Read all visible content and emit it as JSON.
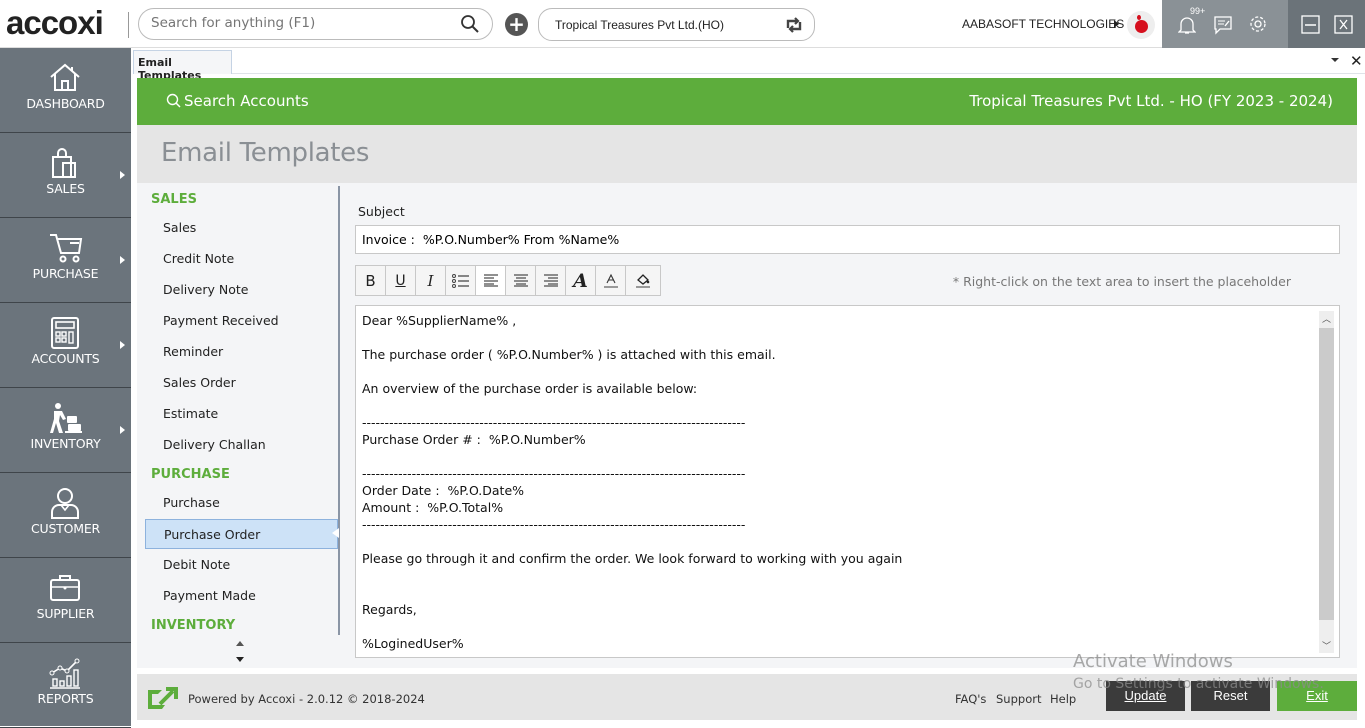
{
  "app": {
    "logo": "accoxi",
    "search_placeholder": "Search for anything (F1)",
    "company": "Tropical Treasures Pvt Ltd.(HO)",
    "org_name": "AABASOFT TECHNOLOGIES",
    "notification_count": "99+"
  },
  "sidebar": {
    "items": [
      {
        "label": "DASHBOARD",
        "icon": "home-icon"
      },
      {
        "label": "SALES",
        "icon": "shopping-bag-icon"
      },
      {
        "label": "PURCHASE",
        "icon": "cart-icon"
      },
      {
        "label": "ACCOUNTS",
        "icon": "calculator-icon"
      },
      {
        "label": "INVENTORY",
        "icon": "trolley-icon"
      },
      {
        "label": "CUSTOMER",
        "icon": "user-icon"
      },
      {
        "label": "SUPPLIER",
        "icon": "briefcase-icon"
      },
      {
        "label": "REPORTS",
        "icon": "chart-icon"
      }
    ]
  },
  "tab": {
    "label": "Email Templates"
  },
  "banner": {
    "search_label": "Search Accounts",
    "company_fy": "Tropical Treasures Pvt Ltd. - HO (FY 2023 - 2024)"
  },
  "page": {
    "title": "Email Templates"
  },
  "templates": {
    "groups": [
      {
        "name": "SALES",
        "items": [
          "Sales",
          "Credit Note",
          "Delivery Note",
          "Payment Received",
          "Reminder",
          "Sales Order",
          "Estimate",
          "Delivery Challan"
        ]
      },
      {
        "name": "PURCHASE",
        "items": [
          "Purchase",
          "Purchase Order",
          "Debit Note",
          "Payment Made"
        ]
      },
      {
        "name": "INVENTORY",
        "items": []
      }
    ],
    "selected": "Purchase Order"
  },
  "editor": {
    "subject_label": "Subject",
    "subject_value": "Invoice :  %P.O.Number% From %Name%",
    "hint": "* Right-click on the text area to insert the placeholder",
    "toolbar": [
      "bold",
      "underline",
      "italic",
      "bullet-list",
      "align-left",
      "align-center",
      "align-right",
      "font",
      "font-color",
      "fill-color"
    ],
    "body": "Dear %SupplierName% ,\n\nThe purchase order ( %P.O.Number% ) is attached with this email.\n\nAn overview of the purchase order is available below:\n\n-------------------------------------------------------------------------------------\nPurchase Order # :  %P.O.Number%\n\n-------------------------------------------------------------------------------------\nOrder Date :  %P.O.Date%\nAmount :  %P.O.Total%\n-------------------------------------------------------------------------------------\n\nPlease go through it and confirm the order. We look forward to working with you again\n\n\nRegards,\n\n%LoginedUser%"
  },
  "footer": {
    "powered": "Powered by Accoxi - 2.0.12 © 2018-2024",
    "links": [
      "FAQ's",
      "Support",
      "Help"
    ],
    "update": "Update",
    "reset": "Reset",
    "exit": "Exit"
  },
  "watermark": {
    "line1": "Activate Windows",
    "line2": "Go to Settings to activate Windows."
  },
  "colors": {
    "brand_green": "#5dad3c",
    "sidebar": "#6b747c",
    "selected_item": "#cde2f7"
  }
}
